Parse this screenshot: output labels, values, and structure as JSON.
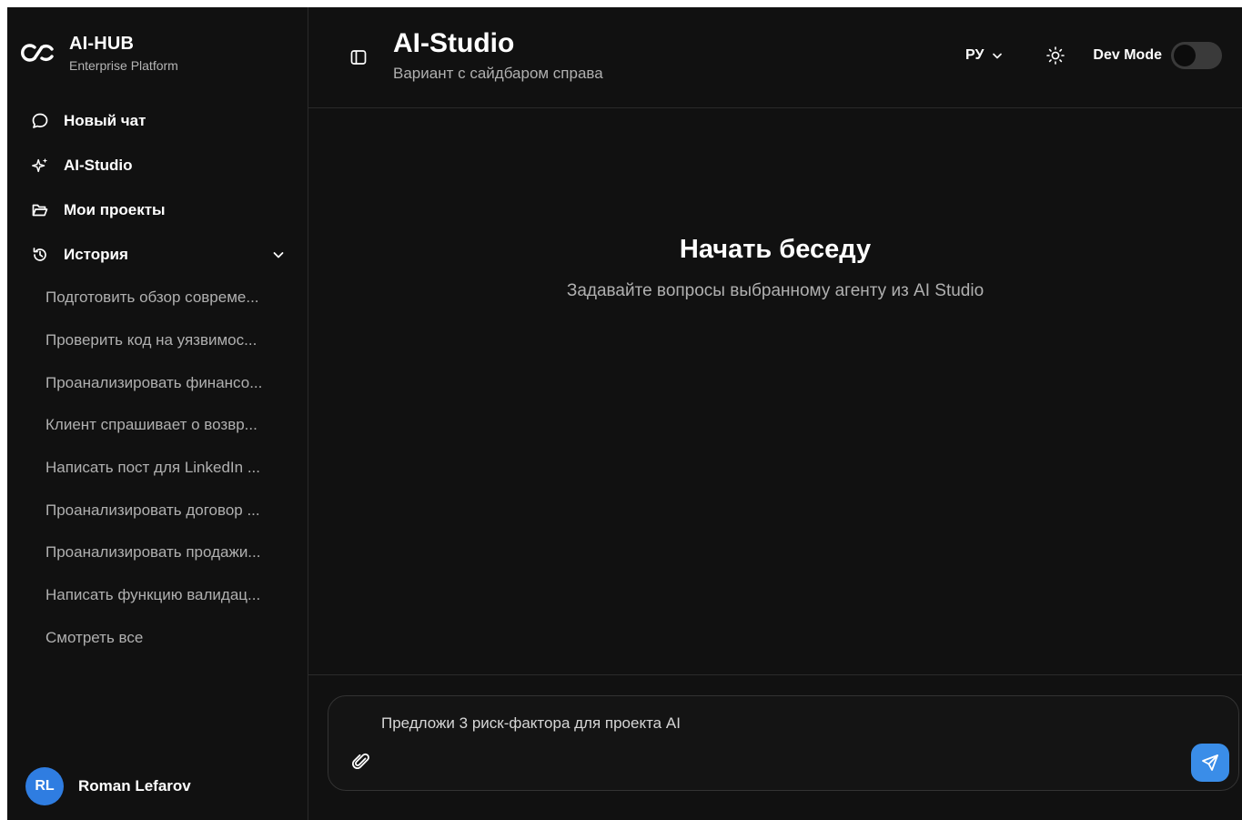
{
  "brand": {
    "name": "AI-HUB",
    "subtitle": "Enterprise Platform",
    "logo_icon": "infinity-logo-icon"
  },
  "nav": [
    {
      "label": "Новый чат",
      "icon": "chat-bubble-icon"
    },
    {
      "label": "AI-Studio",
      "icon": "sparkles-icon"
    },
    {
      "label": "Мои проекты",
      "icon": "folder-open-icon"
    },
    {
      "label": "История",
      "icon": "history-icon",
      "expanded": true
    }
  ],
  "history": [
    "Подготовить обзор совреме...",
    "Проверить код на уязвимос...",
    "Проанализировать финансо...",
    "Клиент спрашивает о возвр...",
    "Написать пост для LinkedIn ...",
    "Проанализировать договор ...",
    "Проанализировать продажи...",
    "Написать функцию валидац...",
    "Смотреть все"
  ],
  "user": {
    "initials": "RL",
    "name": "Roman Lefarov"
  },
  "header": {
    "title": "AI-Studio",
    "subtitle": "Вариант с сайдбаром справа",
    "language": "РУ",
    "dev_mode_label": "Dev Mode",
    "dev_mode_on": false
  },
  "empty_state": {
    "title": "Начать беседу",
    "subtitle": "Задавайте вопросы выбранному агенту из AI Studio"
  },
  "composer": {
    "value": "Предложи 3 риск-фактора для проекта AI"
  },
  "colors": {
    "background": "#111111",
    "accent": "#3a8de8",
    "avatar": "#2f7de1",
    "muted_text": "#b0b0b0"
  }
}
